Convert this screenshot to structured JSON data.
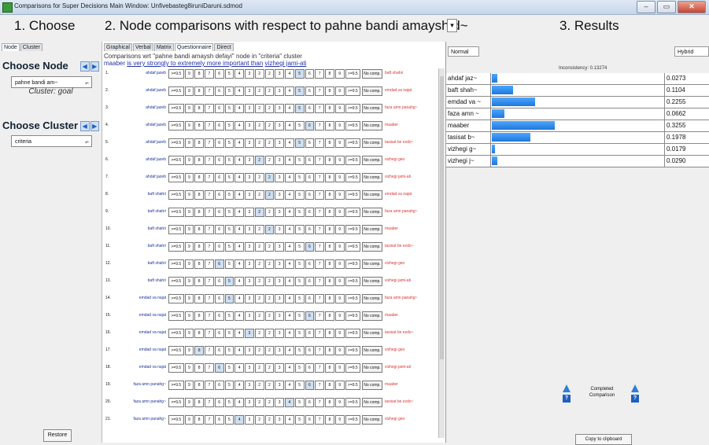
{
  "window": {
    "title": "Comparisons for Super Decisions Main Window: Unfivebasteg8iruniDaruni.sdmod",
    "buttons": [
      "–",
      "▭",
      "✕"
    ]
  },
  "headings": {
    "choose": "1. Choose",
    "node_comparisons": "2. Node comparisons with respect to pahne bandi amaysh d~",
    "results": "3. Results"
  },
  "left": {
    "tabs": [
      "Node",
      "Cluster"
    ],
    "choose_node_label": "Choose Node",
    "node_value": "pahne bandi am~",
    "cluster_goal": "Cluster: goal",
    "choose_cluster_label": "Choose Cluster",
    "cluster_value": "criteria",
    "restore": "Restore"
  },
  "middle": {
    "tabs": [
      "Graphical",
      "Verbal",
      "Matrix",
      "Questionnaire",
      "Direct"
    ],
    "header_line1": "Comparisons wrt \"pahne bandi amaysh defayi\" node in \"criteria\" cluster",
    "header_left": "maaber",
    "header_mid": "is very strongly to extremely more important than",
    "header_right": "vizhegi jami-ati",
    "scale": [
      ">=9.5",
      "9",
      "8",
      "7",
      "6",
      "5",
      "4",
      "3",
      "2",
      "2",
      "3",
      "4",
      "5",
      "6",
      "7",
      "8",
      "9",
      ">=9.5"
    ],
    "nocomp_label": "No comp.",
    "rows": [
      {
        "num": "1.",
        "left": "ahdaf jazeb",
        "right": "baft shahri",
        "sel": 12
      },
      {
        "num": "2.",
        "left": "ahdaf jazeb",
        "right": "emdad va najat",
        "sel": 12
      },
      {
        "num": "3.",
        "left": "ahdaf jazeb",
        "right": "faza amn panahg~",
        "sel": 12
      },
      {
        "num": "4.",
        "left": "ahdaf jazeb",
        "right": "maaber",
        "sel": 13
      },
      {
        "num": "5.",
        "left": "ahdaf jazeb",
        "right": "tasisat be ezdo~",
        "sel": 12
      },
      {
        "num": "6.",
        "left": "ahdaf jazeb",
        "right": "vizhegi geo",
        "sel": 8
      },
      {
        "num": "7.",
        "left": "ahdaf jazeb",
        "right": "vizhegi jami-ati",
        "sel": 9
      },
      {
        "num": "8.",
        "left": "baft shahri",
        "right": "emdad va najat",
        "sel": 9
      },
      {
        "num": "9.",
        "left": "baft shahri",
        "right": "faza amn panahg~",
        "sel": 8
      },
      {
        "num": "10.",
        "left": "baft shahri",
        "right": "maaber",
        "sel": 9
      },
      {
        "num": "11.",
        "left": "baft shahri",
        "right": "tasisat be ezdo~",
        "sel": 13
      },
      {
        "num": "12.",
        "left": "baft shahri",
        "right": "vizhegi geo",
        "sel": 4
      },
      {
        "num": "13.",
        "left": "baft shahri",
        "right": "vizhegi jami-ati",
        "sel": 5
      },
      {
        "num": "14.",
        "left": "emdad va najat",
        "right": "faza amn panahg~",
        "sel": 5
      },
      {
        "num": "15.",
        "left": "emdad va najat",
        "right": "maaber",
        "sel": 13
      },
      {
        "num": "16.",
        "left": "emdad va najat",
        "right": "tasisat be ezdo~",
        "sel": 7
      },
      {
        "num": "17.",
        "left": "emdad va najat",
        "right": "vizhegi geo",
        "sel": 2
      },
      {
        "num": "18.",
        "left": "emdad va najat",
        "right": "vizhegi jami-ati",
        "sel": 4
      },
      {
        "num": "19.",
        "left": "faza amn panahg~",
        "right": "maaber",
        "sel": 13
      },
      {
        "num": "20.",
        "left": "faza amn panahg~",
        "right": "tasisat be ezdo~",
        "sel": 11
      },
      {
        "num": "21.",
        "left": "faza amn panahg~",
        "right": "vizhegi geo",
        "sel": 6
      }
    ]
  },
  "right": {
    "mode_left": "Normal",
    "mode_right": "Hybrid",
    "inconsistency": "Inconsistency: 0.13274",
    "results": [
      {
        "name": "ahdaf jaz~",
        "value": "0.0273",
        "fraction": 0.0273
      },
      {
        "name": "baft shah~",
        "value": "0.1104",
        "fraction": 0.1104
      },
      {
        "name": "emdad va ~",
        "value": "0.2255",
        "fraction": 0.2255
      },
      {
        "name": "faza amn ~",
        "value": "0.0662",
        "fraction": 0.0662
      },
      {
        "name": "maaber",
        "value": "0.3255",
        "fraction": 0.3255
      },
      {
        "name": "tasisat b~",
        "value": "0.1978",
        "fraction": 0.1978
      },
      {
        "name": "vizhegi g~",
        "value": "0.0179",
        "fraction": 0.0179
      },
      {
        "name": "vizhegi j~",
        "value": "0.0290",
        "fraction": 0.029
      }
    ],
    "completed": "Completed Comparison",
    "copy": "Copy to clipboard"
  }
}
